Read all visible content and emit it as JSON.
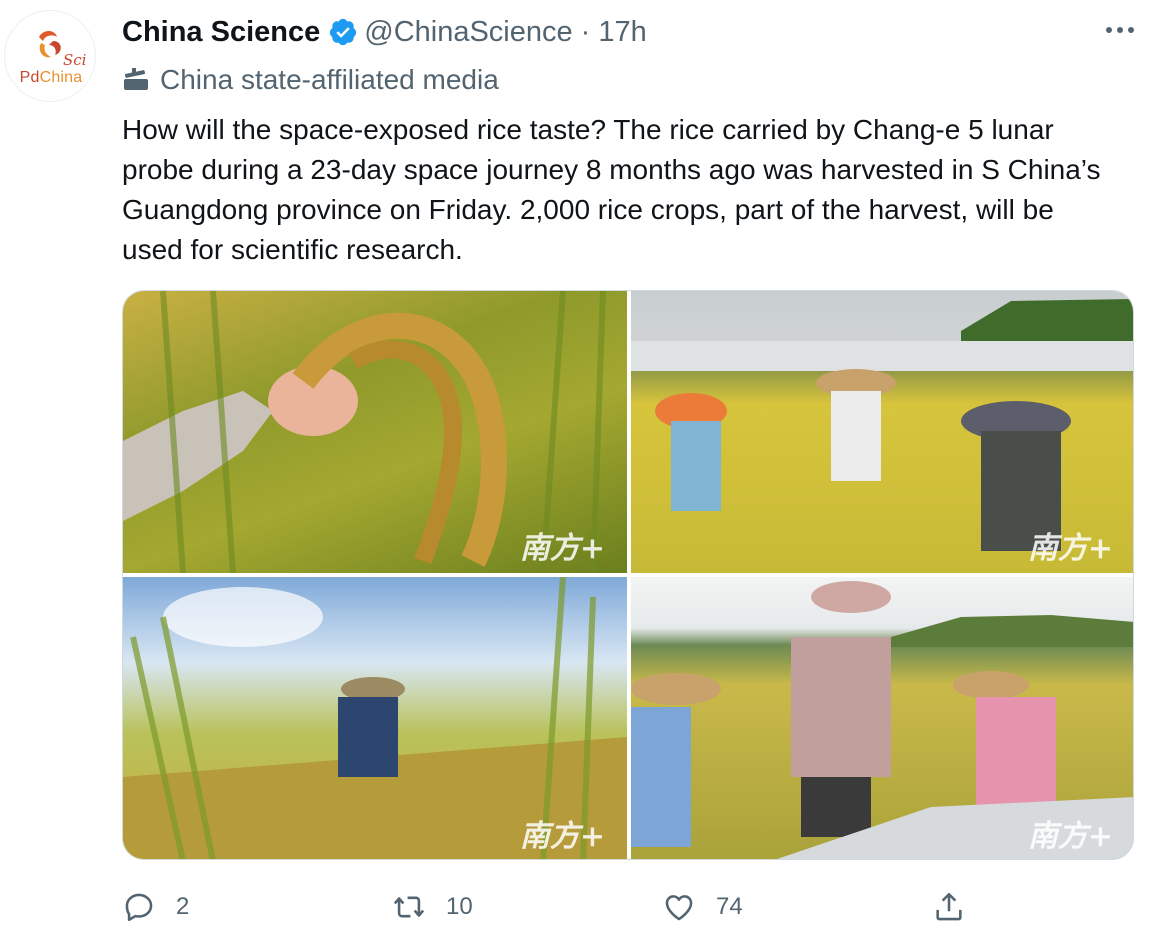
{
  "account": {
    "avatar_sci": "Sci",
    "avatar_pd": "Pd",
    "avatar_china": "China",
    "name": "China Science",
    "handle": "@ChinaScience",
    "separator": "·",
    "time": "17h",
    "affiliation": "China state-affiliated media"
  },
  "tweet": {
    "text": "How will the space-exposed rice taste? The rice carried by Chang-e 5 lunar probe during a 23-day space journey 8 months ago was harvested in S China’s Guangdong province on Friday. 2,000 rice crops, part of the harvest, will be used for scientific research."
  },
  "media": {
    "photos": [
      {
        "watermark": "南方+"
      },
      {
        "watermark": "南方+"
      },
      {
        "watermark": "南方+"
      },
      {
        "watermark": "南方+"
      }
    ]
  },
  "actions": {
    "reply_count": "2",
    "retweet_count": "10",
    "like_count": "74"
  },
  "colors": {
    "accent": "#1d9bf0",
    "secondary_text": "#536471",
    "brand_red": "#c8472d"
  },
  "icons": [
    "verified-badge-icon",
    "more-icon",
    "microphone-icon",
    "reply-icon",
    "retweet-icon",
    "like-icon",
    "share-icon"
  ]
}
